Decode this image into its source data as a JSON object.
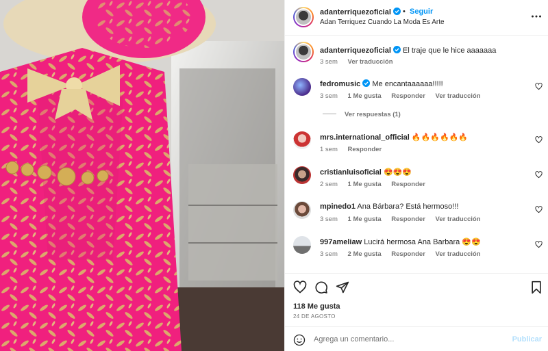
{
  "post": {
    "author": "adanterriquezoficial",
    "follow_label": "Seguir",
    "separator": "•",
    "location": "Adan Terriquez Cuando La Moda Es Arte",
    "more_icon": "more-horizontal-icon"
  },
  "caption": {
    "user": "adanterriquezoficial",
    "text": "El traje que le hice aaaaaaa",
    "time": "3 sem",
    "translate": "Ver traducción"
  },
  "comments": [
    {
      "user": "fedromusic",
      "verified": true,
      "text": "Me encantaaaaaa!!!!!",
      "time": "3 sem",
      "likes": "1 Me gusta",
      "reply": "Responder",
      "translate": "Ver traducción"
    },
    {
      "user": "mrs.international_official",
      "verified": false,
      "text": "🔥🔥🔥🔥🔥🔥",
      "time": "1 sem",
      "likes": "",
      "reply": "Responder",
      "translate": ""
    },
    {
      "user": "cristianluisoficial",
      "verified": false,
      "text": "😍😍😍",
      "time": "2 sem",
      "likes": "1 Me gusta",
      "reply": "Responder",
      "translate": ""
    },
    {
      "user": "mpinedo1",
      "verified": false,
      "text": "Ana Bárbara? Está hermoso!!!",
      "time": "3 sem",
      "likes": "1 Me gusta",
      "reply": "Responder",
      "translate": "Ver traducción"
    },
    {
      "user": "997ameliaw",
      "verified": false,
      "text": "Lucirá hermosa Ana Barbara 😍😍",
      "time": "3 sem",
      "likes": "2 Me gusta",
      "reply": "Responder",
      "translate": "Ver traducción"
    }
  ],
  "view_replies": "Ver respuestas (1)",
  "stats": {
    "likes": "118 Me gusta",
    "date": "24 DE AGOSTO"
  },
  "composer": {
    "placeholder": "Agrega un comentario...",
    "publish": "Publicar"
  },
  "colors": {
    "link": "#0095f6",
    "verified": "#0095f6",
    "muted": "#737373",
    "suit_pink": "#f0207e",
    "embroidery_gold": "#d9b86a"
  }
}
